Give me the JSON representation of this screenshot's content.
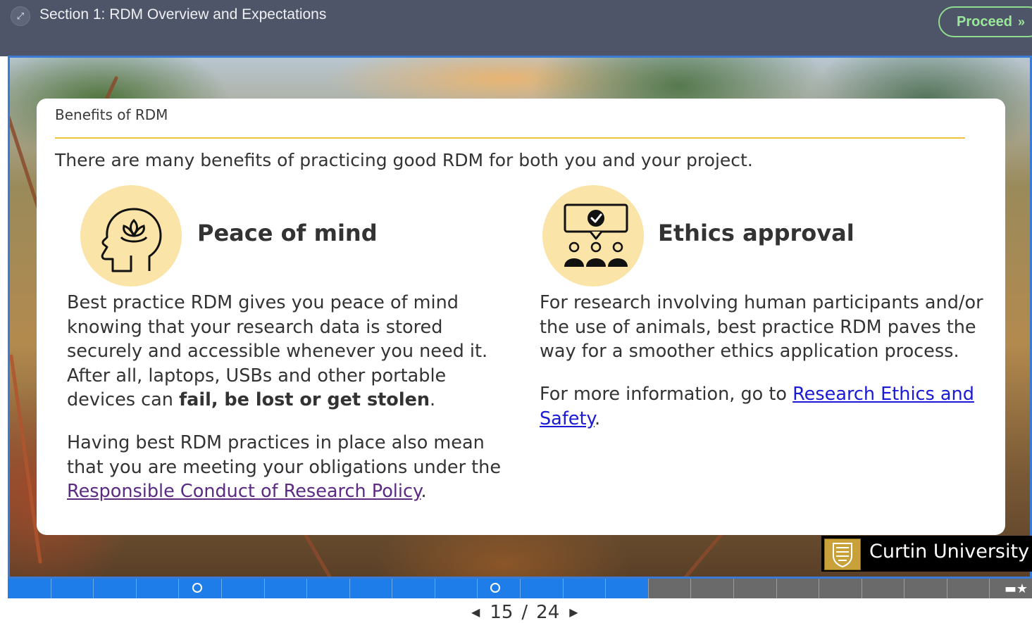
{
  "header": {
    "section_title": "Section 1: RDM Overview and Expectations",
    "proceed_label": "Proceed",
    "proceed_icon": "chevrons-right-icon",
    "expand_icon": "expand-arrows-icon"
  },
  "card": {
    "title": "Benefits of RDM",
    "intro": "There are many benefits of practicing good RDM for both you and your project.",
    "left": {
      "heading": "Peace of mind",
      "icon": "head-lotus-icon",
      "para1_text": "Best practice RDM gives you peace of mind knowing that your research data is stored securely and accessible whenever you need it. After all, laptops, USBs and other portable devices can ",
      "para1_bold": "fail, be lost or get stolen",
      "para1_end": ".",
      "para2_text": "Having best RDM practices in place also mean that you are meeting your obligations under the ",
      "para2_link": "Responsible Conduct of Research Policy",
      "para2_end": "."
    },
    "right": {
      "heading": "Ethics approval",
      "icon": "group-checkmark-icon",
      "para1_text": "For research involving human participants and/or the use of animals, best practice RDM paves the way for a smoother ethics application process.",
      "para2_text": "For more information, go to ",
      "para2_link": "Research Ethics and Safety",
      "para2_end": "."
    }
  },
  "logo": {
    "text": "Curtin University"
  },
  "progress": {
    "current": 15,
    "total": 24,
    "fill_color": "#1e7de8",
    "track_color": "#6a6a6a"
  },
  "pager": {
    "current": "15",
    "separator": "/",
    "total": "24",
    "prev_icon": "triangle-left-icon",
    "next_icon": "triangle-right-icon"
  },
  "colors": {
    "topbar": "#4f5568",
    "accent_rule": "#f1c33a",
    "icon_bg": "#fbe4a8",
    "proceed": "#9be89b"
  }
}
